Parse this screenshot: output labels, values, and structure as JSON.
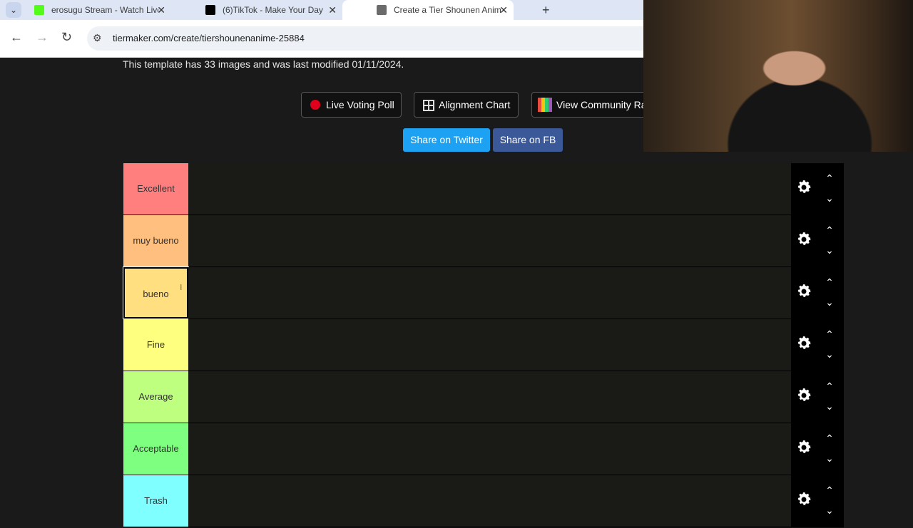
{
  "browser": {
    "tabs": [
      {
        "title": "erosugu Stream - Watch Live on",
        "favicon_color": "#53fc18"
      },
      {
        "title": "(6)TikTok - Make Your Day",
        "favicon_color": "#000000"
      },
      {
        "title": "Create a Tier Shounen Anime Ti",
        "favicon_color": "#6b6b6b"
      }
    ],
    "active_tab": 2,
    "url": "tiermaker.com/create/tiershounenanime-25884"
  },
  "page": {
    "info_text": "This template has 33 images and was last modified 01/11/2024.",
    "buttons": {
      "live_voting": "Live Voting Poll",
      "alignment_chart": "Alignment Chart",
      "community_rank": "View Community Ra"
    },
    "share": {
      "twitter": "Share on Twitter",
      "fb": "Share on FB",
      "twitter_color": "#1da1f2",
      "fb_color": "#3b5998"
    }
  },
  "tiers": [
    {
      "label": "Excellent",
      "color": "#ff7f7f"
    },
    {
      "label": "muy bueno",
      "color": "#ffbf7f"
    },
    {
      "label": "bueno",
      "color": "#ffdf7f",
      "editing": true
    },
    {
      "label": "Fine",
      "color": "#ffff7f"
    },
    {
      "label": "Average",
      "color": "#bfff7f"
    },
    {
      "label": "Acceptable",
      "color": "#7fff7f"
    },
    {
      "label": "Trash",
      "color": "#7fffff"
    }
  ]
}
